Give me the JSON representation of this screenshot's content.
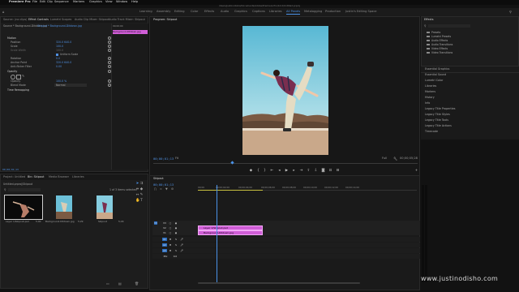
{
  "app": {
    "title": "Premiere Pro",
    "menu": [
      "File",
      "Edit",
      "Clip",
      "Sequence",
      "Markers",
      "Graphics",
      "View",
      "Window",
      "Help"
    ],
    "window_title": "/Users/justinodisho/Documents/Adobe/Premiere Pro/14.0/Untitled.prproj"
  },
  "workspaces": [
    "Learning",
    "Assembly",
    "Editing",
    "Color",
    "Effects",
    "Audio",
    "Graphics",
    "Captions",
    "Libraries",
    "All Panels",
    "Metalogging",
    "Production",
    "Justin's Editing Space"
  ],
  "active_workspace_index": 9,
  "effect_controls": {
    "tabs": [
      "Source: (no clips)",
      "Effect Controls",
      "Lumetri Scopes",
      "Audio Clip Mixer: Skipout",
      "Audio Track Mixer: Skipout"
    ],
    "active_tab": 1,
    "header_source": "Source * Background-Ditdown.jpg",
    "header_clip": "Skipout * Background-Ditdown.jpg",
    "rows": [
      {
        "label": "Motion",
        "value": ""
      },
      {
        "label": "Position",
        "value": "320.0    640.0"
      },
      {
        "label": "Scale",
        "value": "100.0"
      },
      {
        "label": "Scale Width",
        "value": "100.0"
      },
      {
        "label": "",
        "value": "Uniform Scale"
      },
      {
        "label": "Rotation",
        "value": "0.0"
      },
      {
        "label": "Anchor Point",
        "value": "320.0    640.0"
      },
      {
        "label": "Anti-flicker Filter",
        "value": "0.00"
      },
      {
        "label": "Opacity",
        "value": ""
      },
      {
        "label": "",
        "value": ""
      },
      {
        "label": "Opacity",
        "value": "100.0 %"
      },
      {
        "label": "Blend Mode",
        "value": "Normal"
      },
      {
        "label": "Time Remapping",
        "value": ""
      }
    ],
    "mini_timecode": "00;00;00",
    "mini_clip": "Background-Ditdown.jpg",
    "bottom_timecode": "00;00;01;13"
  },
  "program": {
    "label": "Program: Skipout",
    "timecode_left": "00;00;01;13",
    "fit": "Fit",
    "quality": "Full",
    "timecode_right": "00;00;05;28",
    "controls": [
      "marker",
      "in",
      "out",
      "go-in",
      "step-back",
      "play",
      "step-forward",
      "go-out",
      "lift",
      "extract",
      "export-frame",
      "insert",
      "overwrite",
      "compare",
      "plus"
    ]
  },
  "project": {
    "tabs": [
      "Project: Untitled",
      "Bin: Skipout",
      "Media Browser",
      "Libraries"
    ],
    "active_tab": 1,
    "path": "Untitled.prproj\\Skipout",
    "count": "1 of 3 items selected",
    "items": [
      {
        "name": "Layer 1/Skipout.psd",
        "dur": "5;00"
      },
      {
        "name": "Background-Ditdown.jpg",
        "dur": "5;29"
      },
      {
        "name": "Skipout",
        "dur": "5;29"
      }
    ]
  },
  "timeline": {
    "tab": "Skipout",
    "timecode": "00;00;01;13",
    "ruler": [
      "00;00",
      "00;00;02;00",
      "00;00;04;00",
      "00;00;06;00",
      "00;00;08;00",
      "00;00;10;00",
      "00;00;12;00",
      "00;00;14;00"
    ],
    "tracks": [
      "V3",
      "V2",
      "V1",
      "A1",
      "A2",
      "A3",
      "Mix"
    ],
    "mix_value": "0.0",
    "clips": [
      {
        "label": "Layer 1/Skipout.psd",
        "track": "V2"
      },
      {
        "label": "Background-Ditdown.jpg",
        "track": "V1"
      }
    ]
  },
  "effects_panel": {
    "title": "Effects",
    "folders": [
      "Presets",
      "Lumetri Presets",
      "Audio Effects",
      "Audio Transitions",
      "Video Effects",
      "Video Transitions"
    ],
    "panels": [
      "Essential Graphics",
      "Essential Sound",
      "Lumetri Color",
      "Libraries",
      "Markers",
      "History",
      "Info",
      "Legacy Title Properties",
      "Legacy Title Styles",
      "Legacy Title Tools",
      "Legacy Title Actions",
      "Timecode"
    ]
  },
  "watermark": "www.justinodisho.com",
  "colors": {
    "accent": "#4a92e8",
    "clip": "#d05ed7",
    "timecode": "#4f8fe0"
  }
}
